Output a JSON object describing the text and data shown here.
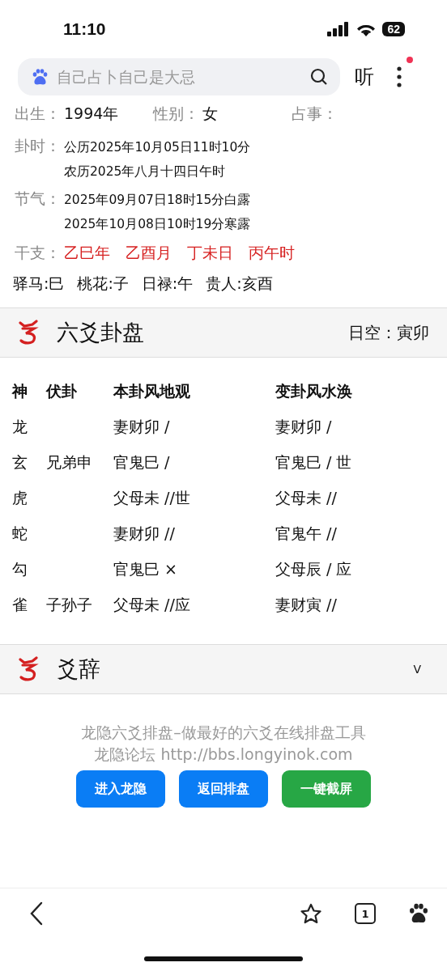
{
  "status_bar": {
    "time": "11:10",
    "battery": "62"
  },
  "search": {
    "placeholder": "自己占卜自己是大忌"
  },
  "toolbar": {
    "listen": "听",
    "has_notification": true
  },
  "info": {
    "birth_label": "出生：",
    "birth": "1994年",
    "gender_label": "性别：",
    "gender": "女",
    "matter_label": "占事：",
    "time_label": "卦时：",
    "solar": "公历2025年10月05日11时10分",
    "lunar": "农历2025年八月十四日午时",
    "term_label": "节气：",
    "terms": [
      "2025年09月07日18时15分白露",
      "2025年10月08日10时19分寒露"
    ],
    "ganzhi_label": "干支：",
    "ganzhi": [
      "乙巳年",
      "乙酉月",
      "丁未日",
      "丙午时"
    ],
    "shensha": [
      "驿马:巳",
      "桃花:子",
      "日禄:午",
      "贵人:亥酉"
    ]
  },
  "chart_section": {
    "title": "六爻卦盘",
    "void_label": "日空：",
    "void": "寅卯"
  },
  "table": {
    "columns": [
      "神",
      "伏卦",
      "本卦风地观",
      "变卦风水涣"
    ],
    "rows": [
      {
        "god": "龙",
        "base": "妻财卯  /",
        "changed": "妻财卯  /"
      },
      {
        "god": "玄",
        "hidden": "兄弟申",
        "base": "官鬼巳  /",
        "changed": "官鬼巳  / 世"
      },
      {
        "god": "虎",
        "base": "父母未 //世",
        "changed": "父母未 //"
      },
      {
        "god": "蛇",
        "base": "妻财卯 //",
        "changed": "官鬼午 //"
      },
      {
        "god": "勾",
        "base": "官鬼巳 ×",
        "changed": "父母辰  / 应"
      },
      {
        "god": "雀",
        "hidden": "子孙子",
        "base": "父母未 //应",
        "changed": "妻财寅 //"
      }
    ]
  },
  "yao_section": {
    "title": "爻辞",
    "toggle": "V",
    "expanded": false
  },
  "footer": {
    "slogan": "龙隐六爻排盘–做最好的六爻在线排盘工具",
    "forum": "龙隐论坛 http://bbs.longyinok.com",
    "buttons": [
      {
        "label": "进入龙隐",
        "color": "#0a7df5"
      },
      {
        "label": "返回排盘",
        "color": "#0a7df5"
      },
      {
        "label": "一键截屏",
        "color": "#27a745"
      }
    ]
  },
  "bottom_bar": {
    "tab_count": "1"
  }
}
